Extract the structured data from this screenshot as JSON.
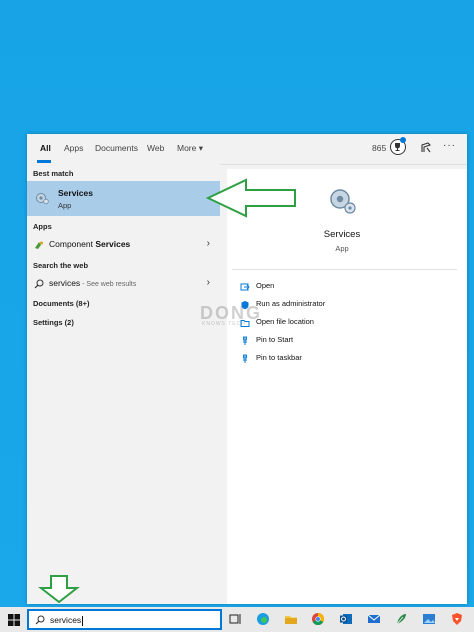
{
  "tabs": [
    {
      "label": "All"
    },
    {
      "label": "Apps"
    },
    {
      "label": "Documents"
    },
    {
      "label": "Web"
    },
    {
      "label": "More ▾"
    }
  ],
  "header": {
    "points": "865"
  },
  "left": {
    "best_match_label": "Best match",
    "best_match": {
      "title": "Services",
      "subtitle": "App"
    },
    "apps_label": "Apps",
    "apps": [
      {
        "label_prefix": "Component ",
        "label_bold": "Services"
      }
    ],
    "web_label": "Search the web",
    "web": {
      "query": "services",
      "suffix": " - See web results"
    },
    "documents_label": "Documents (8+)",
    "settings_label": "Settings (2)"
  },
  "right": {
    "title": "Services",
    "type": "App",
    "actions": [
      {
        "label": "Open"
      },
      {
        "label": "Run as administrator"
      },
      {
        "label": "Open file location"
      },
      {
        "label": "Pin to Start"
      },
      {
        "label": "Pin to taskbar"
      }
    ]
  },
  "watermark": {
    "text": "DONG",
    "sub": "KNOWS TECH"
  },
  "taskbar": {
    "search_value": "services",
    "icons": [
      "task-view-icon",
      "edge-icon",
      "file-explorer-icon",
      "chrome-icon",
      "outlook-icon",
      "mail-icon",
      "feather-icon",
      "photos-icon",
      "brave-icon"
    ]
  },
  "colors": {
    "accent": "#0078d7",
    "selection": "#a9cce9",
    "arrow": "#2ea043"
  }
}
